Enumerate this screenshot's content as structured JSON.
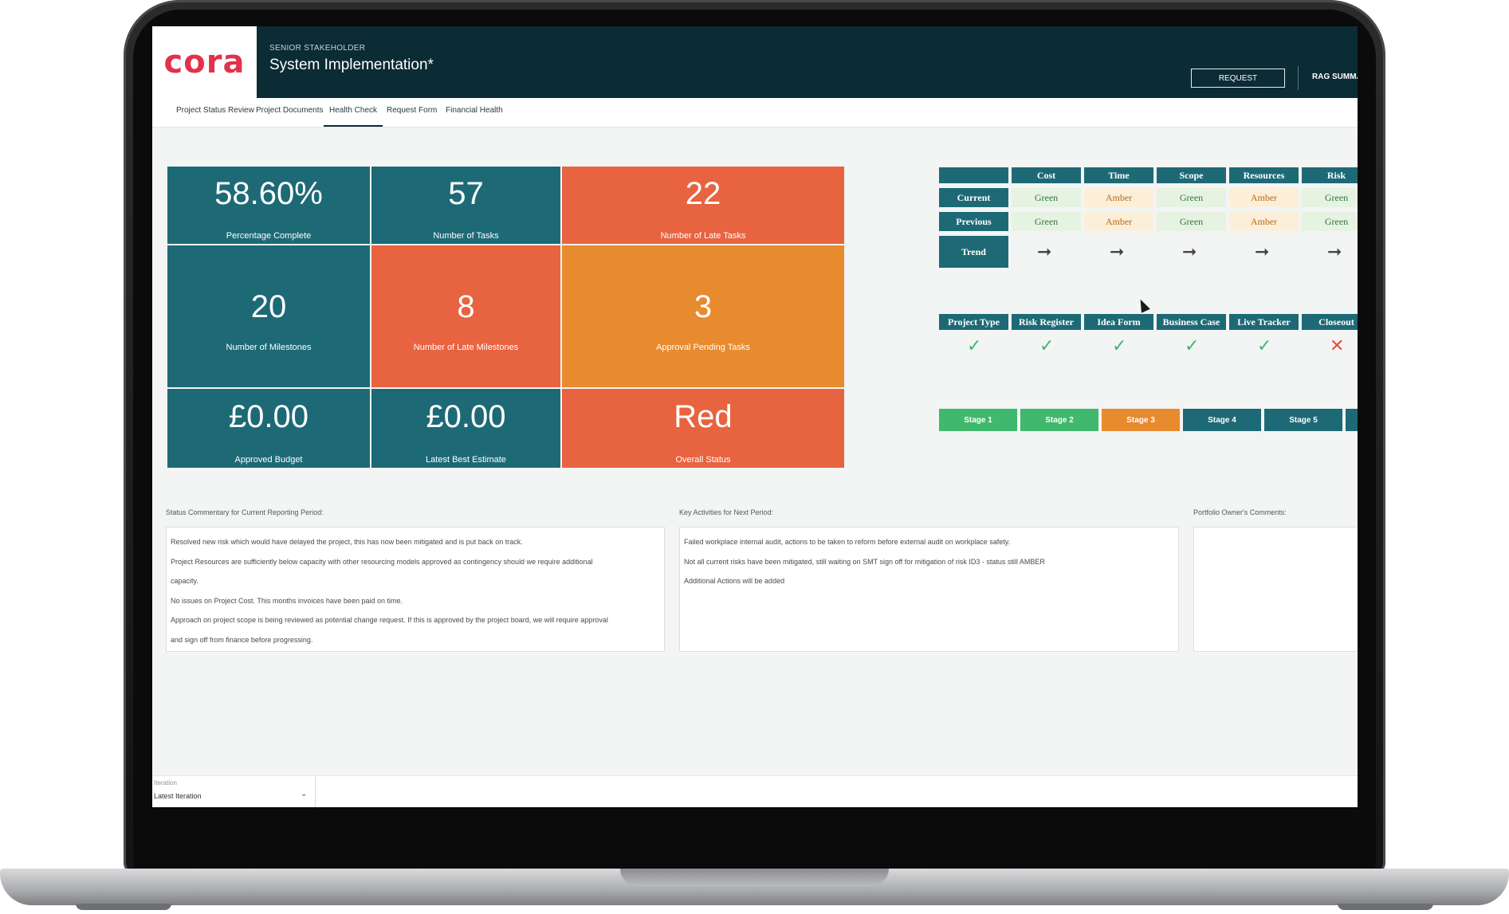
{
  "header": {
    "logo": "cora",
    "subtitle": "SENIOR STAKEHOLDER",
    "title": "System Implementation*",
    "request_button": "REQUEST",
    "rag_summary_button": "RAG SUMMAI"
  },
  "tabs": [
    {
      "label": "Project Status Review"
    },
    {
      "label": "Project Documents"
    },
    {
      "label": "Health Check",
      "active": true
    },
    {
      "label": "Request Form"
    },
    {
      "label": "Financial Health"
    }
  ],
  "kpis": {
    "percentage_complete": {
      "value": "58.60%",
      "label": "Percentage Complete"
    },
    "tasks": {
      "value": "57",
      "label": "Number of Tasks"
    },
    "late_tasks": {
      "value": "22",
      "label": "Number of Late Tasks"
    },
    "milestones": {
      "value": "20",
      "label": "Number of Milestones"
    },
    "late_milestones": {
      "value": "8",
      "label": "Number of Late Milestones"
    },
    "approval_pending": {
      "value": "3",
      "label": "Approval Pending Tasks"
    },
    "approved_budget": {
      "value": "£0.00",
      "label": "Approved Budget"
    },
    "latest_best_estimate": {
      "value": "£0.00",
      "label": "Latest Best Estimate"
    },
    "overall_status": {
      "value": "Red",
      "label": "Overall Status"
    }
  },
  "rag": {
    "columns": [
      "Cost",
      "Time",
      "Scope",
      "Resources",
      "Risk"
    ],
    "row_labels": {
      "current": "Current",
      "previous": "Previous",
      "trend": "Trend"
    },
    "current": [
      "Green",
      "Amber",
      "Green",
      "Amber",
      "Green"
    ],
    "previous": [
      "Green",
      "Amber",
      "Green",
      "Amber",
      "Green"
    ],
    "trend_symbol": "➞"
  },
  "checklist": {
    "items": [
      {
        "label": "Project Type",
        "mark": "✓",
        "ok": true
      },
      {
        "label": "Risk Register",
        "mark": "✓",
        "ok": true
      },
      {
        "label": "Idea Form",
        "mark": "✓",
        "ok": true
      },
      {
        "label": "Business Case",
        "mark": "✓",
        "ok": true
      },
      {
        "label": "Live Tracker",
        "mark": "✓",
        "ok": true
      },
      {
        "label": "Closeout",
        "mark": "✕",
        "ok": false
      }
    ]
  },
  "stages": [
    {
      "label": "Stage 1",
      "status": "green"
    },
    {
      "label": "Stage 2",
      "status": "green"
    },
    {
      "label": "Stage 3",
      "status": "amber"
    },
    {
      "label": "Stage 4",
      "status": "teal"
    },
    {
      "label": "Stage 5",
      "status": "teal"
    }
  ],
  "commentary": {
    "status_label": "Status Commentary for Current Reporting Period:",
    "status_lines": [
      "Resolved new risk which would have delayed the project, this has now been mitigated and is put back on track.",
      "Project Resources are sufficiently below capacity with other resourcing models approved as contingency should we require additional",
      "capacity.",
      "No issues on Project Cost. This months invoices have been paid on time.",
      "Approach on project scope is being reviewed as potential change request. If this is approved by the project board, we will require approval",
      "and sign off from finance before progressing."
    ],
    "key_label": "Key Activities for Next Period:",
    "key_lines": [
      "Failed workplace internal audit, actions to be taken to reform before external audit on workplace safety.",
      "Not all current risks have been mitigated, still waiting on SMT sign off for mitigation of risk ID3 - status still AMBER",
      "Additional Actions will be added"
    ],
    "portfolio_label": "Portfolio Owner's Comments:"
  },
  "footer": {
    "iteration_label": "Iteration",
    "iteration_value": "Latest Iteration"
  }
}
